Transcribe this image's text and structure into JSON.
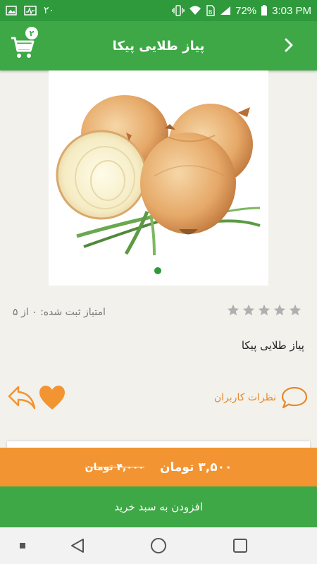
{
  "status_bar": {
    "time": "3:03 PM",
    "battery": "72%",
    "notification_count": "۲۰",
    "icons": [
      "image-icon",
      "activity-icon",
      "vibrate-icon",
      "wifi-icon",
      "sim-icon",
      "signal-icon",
      "battery-icon"
    ]
  },
  "app_bar": {
    "title": "پیاز طلایی پیکا",
    "cart_badge": "۲",
    "icons": [
      "cart-icon",
      "chevron-right-icon"
    ]
  },
  "product": {
    "image": "onion-image",
    "gallery_dots": 1,
    "rating_text": "امتیاز ثبت شده: ۰ از ۵",
    "rating_value": 0,
    "rating_max": 5,
    "name": "پیاز طلایی پیکا"
  },
  "actions": {
    "comments_label": "نظرات کاربران",
    "icons": [
      "comment-icon",
      "heart-icon",
      "share-icon"
    ]
  },
  "price": {
    "old": "۴,۰۰۰ تومان",
    "new": "۳,۵۰۰ تومان"
  },
  "add_to_cart_label": "افزودن به سبد خرید",
  "colors": {
    "primary_green": "#3da845",
    "status_green": "#2e9a3c",
    "accent_orange": "#f29431",
    "comment_orange": "#e58a2b",
    "background": "#f3f1ec"
  },
  "nav_bar": {
    "icons": [
      "recents-dot-icon",
      "back-triangle-icon",
      "home-circle-icon",
      "overview-square-icon"
    ]
  }
}
